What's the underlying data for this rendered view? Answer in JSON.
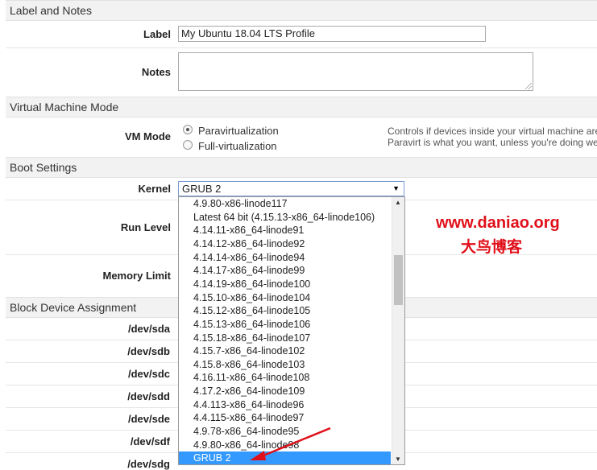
{
  "sections": {
    "label_notes": "Label and Notes",
    "vm_mode": "Virtual Machine Mode",
    "boot": "Boot Settings",
    "block": "Block Device Assignment"
  },
  "label_field": {
    "label": "Label",
    "value": "My Ubuntu 18.04 LTS Profile"
  },
  "notes_field": {
    "label": "Notes",
    "value": ""
  },
  "vm_mode": {
    "label": "VM Mode",
    "options": [
      "Paravirtualization",
      "Full-virtualization"
    ],
    "selected": "Paravirtualization",
    "help_line1": "Controls if devices inside your virtual machine are",
    "help_line2": "Paravirt is what you want, unless you're doing we"
  },
  "kernel": {
    "label": "Kernel",
    "selected": "GRUB 2",
    "options": [
      "4.9.80-x86-linode117",
      "Latest 64 bit (4.15.13-x86_64-linode106)",
      "4.14.11-x86_64-linode91",
      "4.14.12-x86_64-linode92",
      "4.14.14-x86_64-linode94",
      "4.14.17-x86_64-linode99",
      "4.14.19-x86_64-linode100",
      "4.15.10-x86_64-linode104",
      "4.15.12-x86_64-linode105",
      "4.15.13-x86_64-linode106",
      "4.15.18-x86_64-linode107",
      "4.15.7-x86_64-linode102",
      "4.15.8-x86_64-linode103",
      "4.16.11-x86_64-linode108",
      "4.17.2-x86_64-linode109",
      "4.4.113-x86_64-linode96",
      "4.4.115-x86_64-linode97",
      "4.9.78-x86_64-linode95",
      "4.9.80-x86_64-linode98",
      "GRUB 2"
    ]
  },
  "run_level": {
    "label": "Run Level"
  },
  "memory_limit": {
    "label": "Memory Limit"
  },
  "devices": [
    "/dev/sda",
    "/dev/sdb",
    "/dev/sdc",
    "/dev/sdd",
    "/dev/sde",
    "/dev/sdf",
    "/dev/sdg"
  ],
  "watermark": {
    "line1": "www.daniao.org",
    "line2": "大鸟博客"
  },
  "colors": {
    "selected_option": "#3399ff",
    "watermark": "#e0101a",
    "arrow": "#e0101a"
  }
}
